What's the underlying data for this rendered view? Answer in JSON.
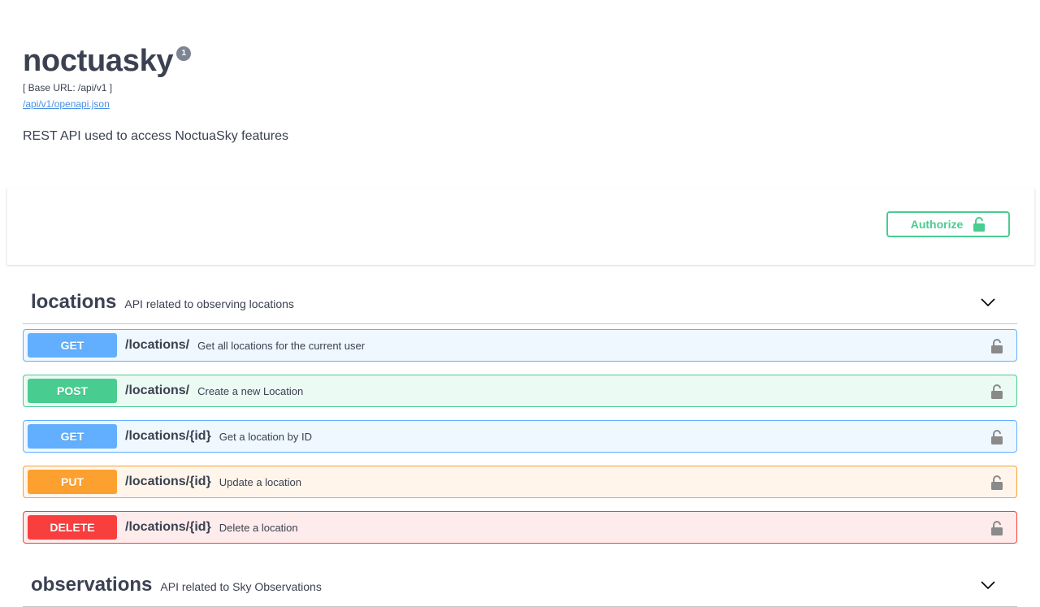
{
  "info": {
    "title": "noctuasky",
    "version": "1",
    "base_url": "[ Base URL: /api/v1 ]",
    "spec_link": "/api/v1/openapi.json",
    "description": "REST API used to access NoctuaSky features"
  },
  "auth": {
    "authorize_label": "Authorize",
    "icon": "unlocked-icon",
    "accent_color": "#49cc90"
  },
  "tags": [
    {
      "name": "locations",
      "description": "API related to observing locations",
      "operations": [
        {
          "method": "GET",
          "path": "/locations/",
          "summary": "Get all locations for the current user"
        },
        {
          "method": "POST",
          "path": "/locations/",
          "summary": "Create a new Location"
        },
        {
          "method": "GET",
          "path": "/locations/{id}",
          "summary": "Get a location by ID"
        },
        {
          "method": "PUT",
          "path": "/locations/{id}",
          "summary": "Update a location"
        },
        {
          "method": "DELETE",
          "path": "/locations/{id}",
          "summary": "Delete a location"
        }
      ]
    },
    {
      "name": "observations",
      "description": "API related to Sky Observations"
    }
  ],
  "method_colors": {
    "GET": "#61affe",
    "POST": "#49cc90",
    "PUT": "#fca130",
    "DELETE": "#f93e3e"
  }
}
